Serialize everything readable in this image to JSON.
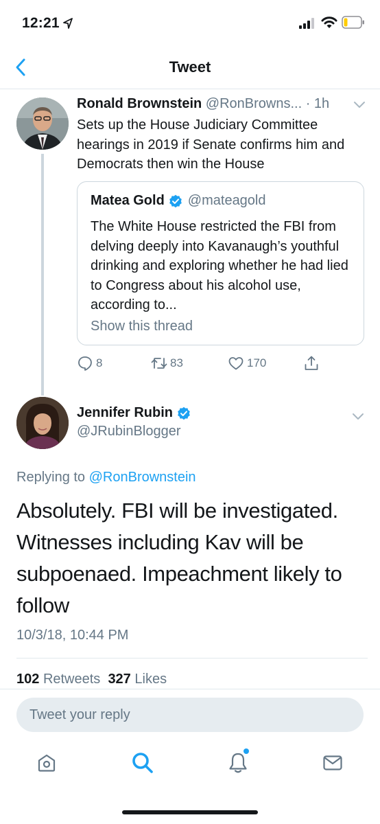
{
  "status": {
    "time": "12:21"
  },
  "nav": {
    "title": "Tweet"
  },
  "parent_tweet": {
    "author_name": "Ronald Brownstein",
    "handle_time": "@RonBrowns... · 1h",
    "text": "Sets up the House Judiciary Committee hearings in 2019 if Senate confirms him and Democrats then win the House",
    "quote": {
      "name": "Matea Gold",
      "handle": "@mateagold",
      "text": "The White House restricted the FBI from delving deeply into Kavanaugh’s youthful drinking and exploring whether he had lied to Congress about his alcohol use, according to...",
      "show_thread": "Show this thread"
    },
    "actions": {
      "replies": "8",
      "retweets": "83",
      "likes": "170"
    }
  },
  "focal_tweet": {
    "author_name": "Jennifer Rubin",
    "handle": "@JRubinBlogger",
    "replying_prefix": "Replying to",
    "replying_to": "@RonBrownstein",
    "text": "Absolutely. FBI will be investigated. Witnesses including Kav will be subpoenaed. Impeachment likely to follow",
    "timestamp": "10/3/18, 10:44 PM",
    "retweets_count": "102",
    "retweets_label": "Retweets",
    "likes_count": "327",
    "likes_label": "Likes"
  },
  "reply": {
    "placeholder": "Tweet your reply"
  },
  "tabs": [
    "home-icon",
    "search-icon",
    "notifications-icon",
    "messages-icon"
  ],
  "colors": {
    "accent": "#1da1f2",
    "text": "#14171a",
    "secondary": "#657786",
    "battery": "#ffcc00"
  }
}
